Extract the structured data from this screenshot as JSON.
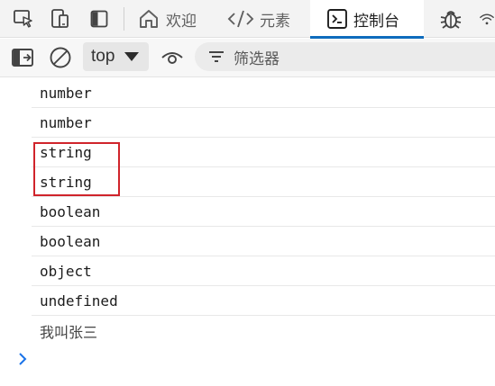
{
  "tabbar": {
    "icons": [
      "inspect-element-icon",
      "device-emulation-icon",
      "sidebar-toggle-icon"
    ],
    "tabs": [
      {
        "label": "欢迎",
        "icon": "home-icon",
        "active": false
      },
      {
        "label": "元素",
        "icon": "code-icon",
        "active": false
      },
      {
        "label": "控制台",
        "icon": "console-icon",
        "active": true
      },
      {
        "label": "",
        "icon": "bug-icon",
        "active": false
      },
      {
        "label": "",
        "icon": "wifi-icon",
        "active": false
      }
    ]
  },
  "toolbar": {
    "context_label": "top",
    "filter_placeholder": "筛选器",
    "icons": [
      "sidebar-panel-icon",
      "clear-console-icon",
      "live-expression-eye-icon",
      "filter-icon"
    ]
  },
  "console": {
    "rows": [
      {
        "text": "number"
      },
      {
        "text": "number"
      },
      {
        "text": "string"
      },
      {
        "text": "string"
      },
      {
        "text": "boolean"
      },
      {
        "text": "boolean"
      },
      {
        "text": "object"
      },
      {
        "text": "undefined"
      },
      {
        "text": "我叫张三"
      }
    ],
    "prompt_icon": "chevron-right-icon"
  },
  "colors": {
    "accent": "#0f6cbd",
    "highlight_border": "#d0242b",
    "prompt": "#1a73e8"
  }
}
